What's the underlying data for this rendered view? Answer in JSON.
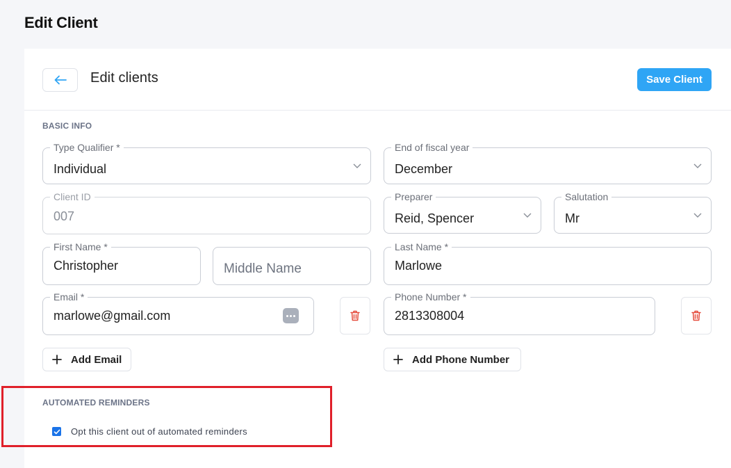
{
  "page": {
    "title": "Edit Client"
  },
  "header": {
    "title": "Edit clients",
    "back_icon": "arrow-left-icon",
    "save_label": "Save Client"
  },
  "sections": {
    "basic_info": "BASIC INFO",
    "automated_reminders": "AUTOMATED REMINDERS"
  },
  "fields": {
    "type_qualifier": {
      "label": "Type Qualifier *",
      "value": "Individual"
    },
    "fiscal_year_end": {
      "label": "End of fiscal year",
      "value": "December"
    },
    "client_id": {
      "label": "Client ID",
      "value": "007"
    },
    "preparer": {
      "label": "Preparer",
      "value": "Reid, Spencer"
    },
    "salutation": {
      "label": "Salutation",
      "value": "Mr"
    },
    "first_name": {
      "label": "First Name *",
      "value": "Christopher"
    },
    "middle_name": {
      "placeholder": "Middle Name"
    },
    "last_name": {
      "label": "Last Name *",
      "value": "Marlowe"
    },
    "email": {
      "label": "Email *",
      "value": "marlowe@gmail.com"
    },
    "phone": {
      "label": "Phone Number *",
      "value": "2813308004"
    }
  },
  "actions": {
    "add_email": "Add Email",
    "add_phone": "Add Phone Number"
  },
  "reminders": {
    "opt_out_label": "Opt this client out of automated reminders",
    "opt_out_checked": true
  },
  "colors": {
    "accent": "#2fa5f5",
    "danger": "#e0202a",
    "checkbox": "#1a73e8"
  }
}
